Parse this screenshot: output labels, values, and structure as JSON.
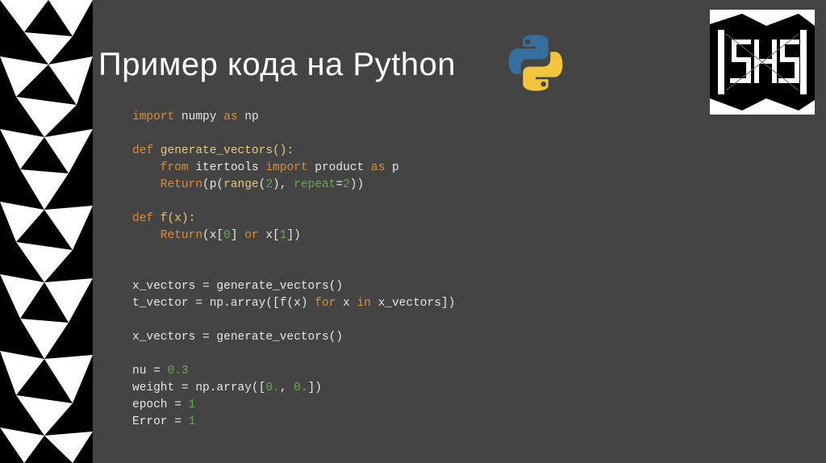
{
  "title": "Пример кода на Python",
  "code": {
    "l1a": "import",
    "l1b": " numpy ",
    "l1c": "as",
    "l1d": " np",
    "l2": "",
    "l3a": "def",
    "l3b": " generate_vectors():",
    "l4a": "    from",
    "l4b": " itertools ",
    "l4c": "import",
    "l4d": " product ",
    "l4e": "as",
    "l4f": " p",
    "l5a": "    Return",
    "l5b": "(p(",
    "l5c": "range",
    "l5d": "(",
    "l5e": "2",
    "l5f": "), ",
    "l5g": "repeat",
    "l5h": "=",
    "l5i": "2",
    "l5j": "))",
    "l6": "",
    "l7a": "def",
    "l7b": " f(x):",
    "l8a": "    Return",
    "l8b": "(x[",
    "l8c": "0",
    "l8d": "] ",
    "l8e": "or",
    "l8f": " x[",
    "l8g": "1",
    "l8h": "])",
    "l9": "",
    "l10": "",
    "l11": "x_vectors = generate_vectors()",
    "l12a": "t_vector = np.array([f(x) ",
    "l12b": "for",
    "l12c": " x ",
    "l12d": "in",
    "l12e": " x_vectors])",
    "l13": "",
    "l14": "x_vectors = generate_vectors()",
    "l15": "",
    "l16a": "nu = ",
    "l16b": "0.3",
    "l17a": "weight = np.array([",
    "l17b": "0.",
    "l17c": ", ",
    "l17d": "0.",
    "l17e": "])",
    "l18a": "epoch = ",
    "l18b": "1",
    "l19a": "Error = ",
    "l19b": "1"
  }
}
